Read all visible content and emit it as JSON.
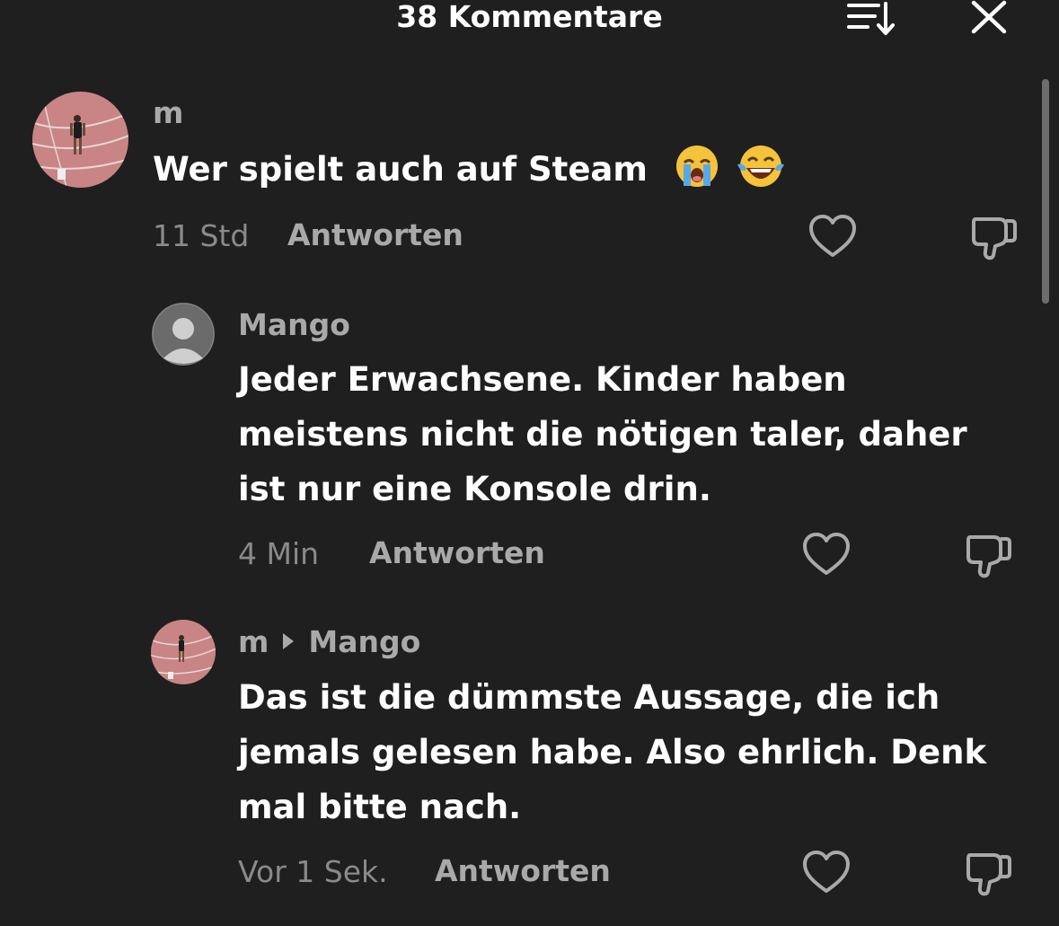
{
  "header": {
    "title": "38 Kommentare"
  },
  "comments": [
    {
      "author": "m",
      "text": "Wer spielt auch auf Steam",
      "emojis": [
        "loudly-crying-face",
        "face-with-tears-of-joy"
      ],
      "time": "11 Std",
      "reply_label": "Antworten"
    },
    {
      "author": "Mango",
      "lines": [
        "Jeder Erwachsene. Kinder haben",
        "meistens nicht die nötigen taler, daher",
        "ist nur eine Konsole drin."
      ],
      "time": "4 Min",
      "reply_label": "Antworten"
    },
    {
      "author": "m",
      "reply_to": "Mango",
      "lines": [
        "Das ist die dümmste Aussage, die ich",
        "jemals gelesen habe. Also ehrlich. Denk",
        "mal bitte nach."
      ],
      "time": "Vor 1 Sek.",
      "reply_label": "Antworten"
    }
  ],
  "icons": {
    "sort": "sort-icon",
    "close": "close-icon",
    "like": "heart-icon",
    "dislike": "thumbs-down-icon"
  },
  "colors": {
    "background": "#1f1f1f",
    "text": "#ffffff",
    "muted": "#a9a9a9",
    "time": "#8a8a8a"
  }
}
